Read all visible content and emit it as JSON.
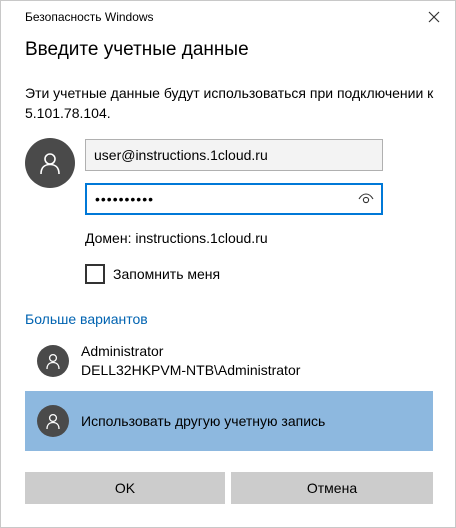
{
  "window": {
    "title": "Безопасность Windows",
    "close_icon": "close-icon"
  },
  "heading": "Введите учетные данные",
  "description": "Эти учетные данные будут использоваться при подключении к 5.101.78.104.",
  "credentials": {
    "username_value": "user@instructions.1cloud.ru",
    "password_value": "••••••••••",
    "reveal_icon": "eye-icon",
    "domain_text": "Домен: instructions.1cloud.ru",
    "remember_label": "Запомнить меня",
    "remember_checked": false
  },
  "more_options_link": "Больше вариантов",
  "accounts": [
    {
      "line1": "Administrator",
      "line2": "DELL32HKPVM-NTB\\Administrator",
      "selected": false
    },
    {
      "line1": "Использовать другую учетную запись",
      "selected": true
    }
  ],
  "buttons": {
    "ok_label": "OK",
    "cancel_label": "Отмена"
  },
  "colors": {
    "accent": "#0078d7",
    "link": "#0063b1",
    "selected_row": "#8db8df",
    "button_bg": "#cccccc",
    "avatar_bg": "#4a4a4a"
  }
}
